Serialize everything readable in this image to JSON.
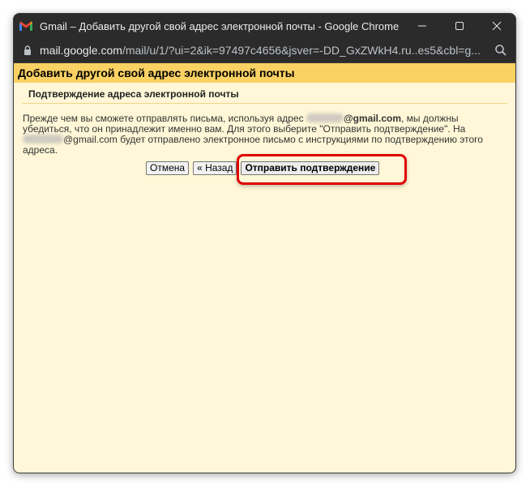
{
  "window": {
    "title": "Gmail – Добавить другой свой адрес электронной почты - Google Chrome"
  },
  "addressbar": {
    "host": "mail.google.com",
    "path": "/mail/u/1/?ui=2&ik=97497c4656&jsver=-DD_GxZWkH4.ru..es5&cbl=g..."
  },
  "page": {
    "header": "Добавить другой свой адрес электронной почты",
    "subheader": "Подтверждение адреса электронной почты",
    "text_part1": "Прежде чем вы сможете отправлять письма, используя адрес ",
    "email_domain_1": "@gmail.com",
    "text_part2": ", мы должны убедиться, что он принадлежит именно вам. Для этого выберите \"Отправить подтверждение\". На ",
    "email_domain_2": "@gmail.com",
    "text_part3": " будет отправлено электронное письмо с инструкциями по подтверждению этого адреса."
  },
  "buttons": {
    "cancel": "Отмена",
    "back": "« Назад",
    "send": "Отправить подтверждение"
  },
  "colors": {
    "header_bg": "#fad163",
    "content_bg": "#fff7d7",
    "highlight": "#e00000"
  }
}
